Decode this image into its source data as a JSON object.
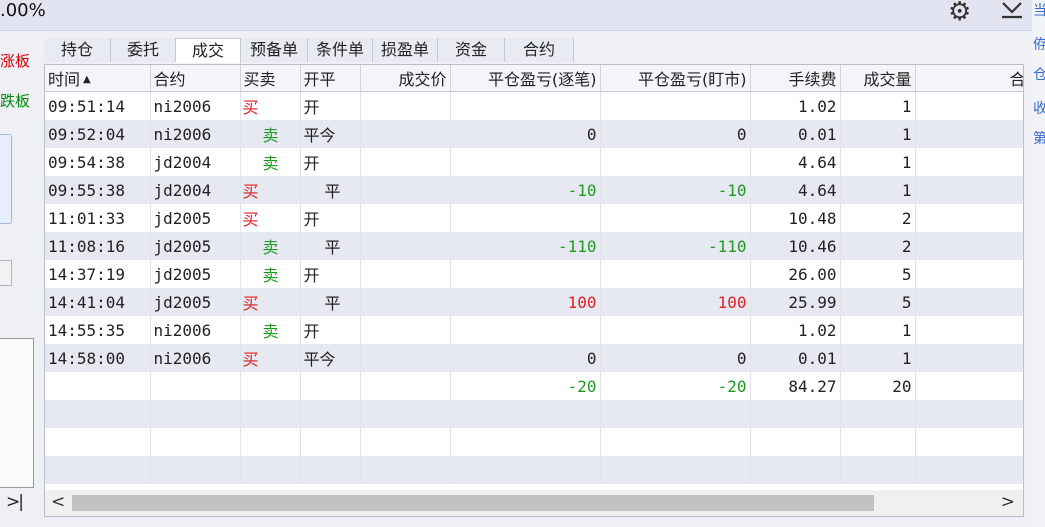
{
  "topbar": {
    "zoom_text": ".00%",
    "gear_icon": "gear-icon",
    "collapse_icon": "chevron-down-icon"
  },
  "left_panel": {
    "red_label": "涨板",
    "green_label": "跌板",
    "skip_label": ">|"
  },
  "tabs": [
    {
      "label": "持仓"
    },
    {
      "label": "委托"
    },
    {
      "label": "成交",
      "active": true
    },
    {
      "label": "预备单"
    },
    {
      "label": "条件单"
    },
    {
      "label": "损盈单"
    },
    {
      "label": "资金"
    },
    {
      "label": "合约"
    }
  ],
  "columns": {
    "time": "时间",
    "sort_indicator": "▲",
    "contract": "合约",
    "side": "买卖",
    "openclose": "开平",
    "price": "成交价",
    "pnl_trade": "平仓盈亏(逐笔)",
    "pnl_mark": "平仓盈亏(盯市)",
    "fee": "手续费",
    "qty": "成交量",
    "extra": "合同"
  },
  "rows": [
    {
      "time": "09:51:14",
      "contract": "ni2006",
      "side": "买",
      "oc": "开",
      "price": "",
      "pnl_trade": "",
      "pnl_mark": "",
      "fee": "1.02",
      "qty": "1"
    },
    {
      "time": "09:52:04",
      "contract": "ni2006",
      "side": "卖",
      "oc": "平今",
      "price": "",
      "pnl_trade": "0",
      "pnl_mark": "0",
      "fee": "0.01",
      "qty": "1"
    },
    {
      "time": "09:54:38",
      "contract": "jd2004",
      "side": "卖",
      "oc": "开",
      "price": "",
      "pnl_trade": "",
      "pnl_mark": "",
      "fee": "4.64",
      "qty": "1"
    },
    {
      "time": "09:55:38",
      "contract": "jd2004",
      "side": "买",
      "oc": "平",
      "price": "",
      "pnl_trade": "-10",
      "pnl_mark": "-10",
      "fee": "4.64",
      "qty": "1"
    },
    {
      "time": "11:01:33",
      "contract": "jd2005",
      "side": "买",
      "oc": "开",
      "price": "",
      "pnl_trade": "",
      "pnl_mark": "",
      "fee": "10.48",
      "qty": "2"
    },
    {
      "time": "11:08:16",
      "contract": "jd2005",
      "side": "卖",
      "oc": "平",
      "price": "",
      "pnl_trade": "-110",
      "pnl_mark": "-110",
      "fee": "10.46",
      "qty": "2"
    },
    {
      "time": "14:37:19",
      "contract": "jd2005",
      "side": "卖",
      "oc": "开",
      "price": "",
      "pnl_trade": "",
      "pnl_mark": "",
      "fee": "26.00",
      "qty": "5"
    },
    {
      "time": "14:41:04",
      "contract": "jd2005",
      "side": "买",
      "oc": "平",
      "price": "",
      "pnl_trade": "100",
      "pnl_mark": "100",
      "fee": "25.99",
      "qty": "5"
    },
    {
      "time": "14:55:35",
      "contract": "ni2006",
      "side": "卖",
      "oc": "开",
      "price": "",
      "pnl_trade": "",
      "pnl_mark": "",
      "fee": "1.02",
      "qty": "1"
    },
    {
      "time": "14:58:00",
      "contract": "ni2006",
      "side": "买",
      "oc": "平今",
      "price": "",
      "pnl_trade": "0",
      "pnl_mark": "0",
      "fee": "0.01",
      "qty": "1"
    }
  ],
  "totals": {
    "pnl_trade": "-20",
    "pnl_mark": "-20",
    "fee": "84.27",
    "qty": "20"
  },
  "colors": {
    "buy": "#e02020",
    "sell": "#1f9a1f",
    "row_alt": "#e6e9f2"
  }
}
